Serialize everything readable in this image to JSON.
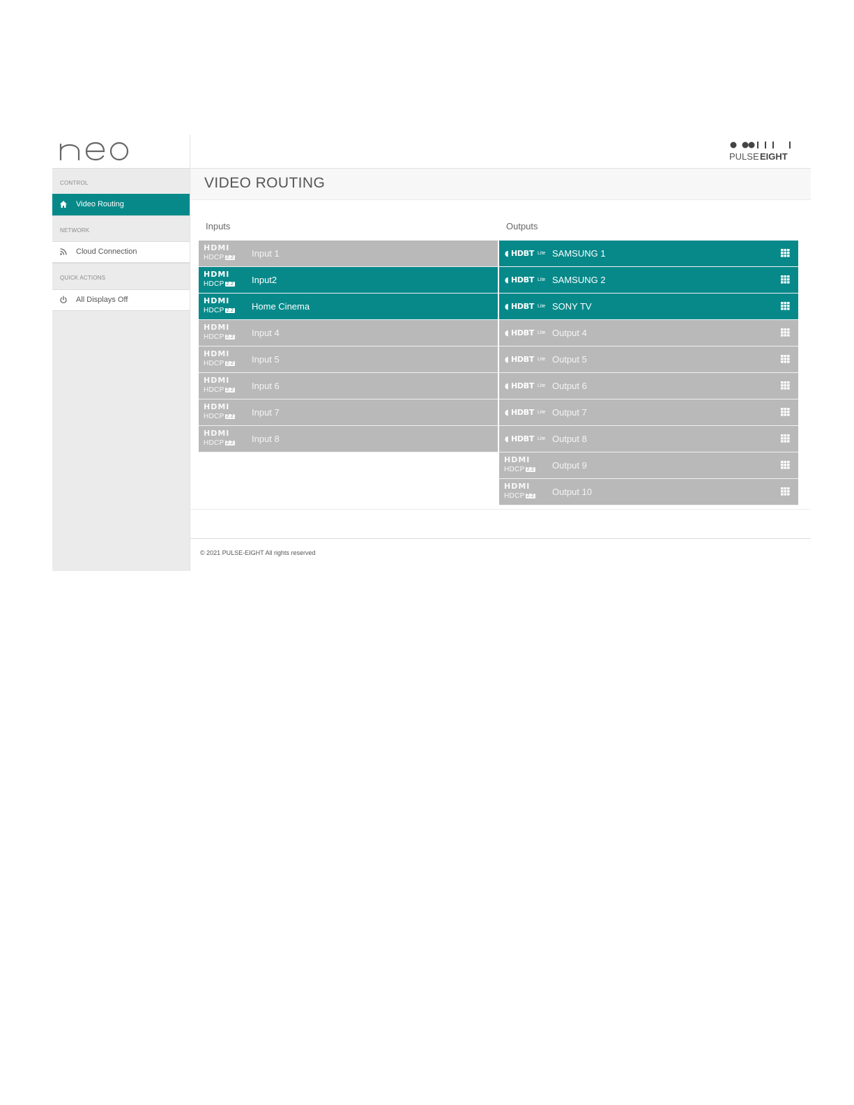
{
  "app": {
    "logo_text": "neo",
    "brand": {
      "top": "PULSE",
      "bottom": "EIGHT"
    }
  },
  "sidebar": {
    "sections": [
      {
        "heading": "CONTROL",
        "items": [
          {
            "label": "Video Routing",
            "icon": "home-icon",
            "active": true
          }
        ]
      },
      {
        "heading": "NETWORK",
        "items": [
          {
            "label": "Cloud Connection",
            "icon": "rss-icon",
            "active": false
          }
        ]
      },
      {
        "heading": "QUICK ACTIONS",
        "items": [
          {
            "label": "All Displays Off",
            "icon": "power-icon",
            "active": false
          }
        ]
      }
    ]
  },
  "main": {
    "title": "VIDEO ROUTING",
    "inputs_title": "Inputs",
    "outputs_title": "Outputs",
    "inputs": [
      {
        "label": "Input 1",
        "type": "hdmi",
        "active": false
      },
      {
        "label": "Input2",
        "type": "hdmi",
        "active": true
      },
      {
        "label": "Home Cinema",
        "type": "hdmi",
        "active": true
      },
      {
        "label": "Input 4",
        "type": "hdmi",
        "active": false
      },
      {
        "label": "Input 5",
        "type": "hdmi",
        "active": false
      },
      {
        "label": "Input 6",
        "type": "hdmi",
        "active": false
      },
      {
        "label": "Input 7",
        "type": "hdmi",
        "active": false
      },
      {
        "label": "Input 8",
        "type": "hdmi",
        "active": false
      }
    ],
    "outputs": [
      {
        "label": "SAMSUNG 1",
        "type": "hdbt",
        "active": true
      },
      {
        "label": "SAMSUNG 2",
        "type": "hdbt",
        "active": true
      },
      {
        "label": "SONY TV",
        "type": "hdbt",
        "active": true
      },
      {
        "label": "Output 4",
        "type": "hdbt",
        "active": false
      },
      {
        "label": "Output 5",
        "type": "hdbt",
        "active": false
      },
      {
        "label": "Output 6",
        "type": "hdbt",
        "active": false
      },
      {
        "label": "Output 7",
        "type": "hdbt",
        "active": false
      },
      {
        "label": "Output 8",
        "type": "hdbt",
        "active": false
      },
      {
        "label": "Output 9",
        "type": "hdmi",
        "active": false
      },
      {
        "label": "Output 10",
        "type": "hdmi",
        "active": false
      }
    ]
  },
  "logos": {
    "hdmi": "HDMI",
    "hdcp": "HDCP",
    "hdcp_version": "2.2",
    "hdbt": "HDBT",
    "hdbt_suffix": "Lite"
  },
  "footer": {
    "text": "© 2021 PULSE-EIGHT All rights reserved"
  },
  "colors": {
    "accent": "#07898a",
    "inactive_row": "#b9b9b9",
    "sidebar_bg": "#ebebeb"
  }
}
